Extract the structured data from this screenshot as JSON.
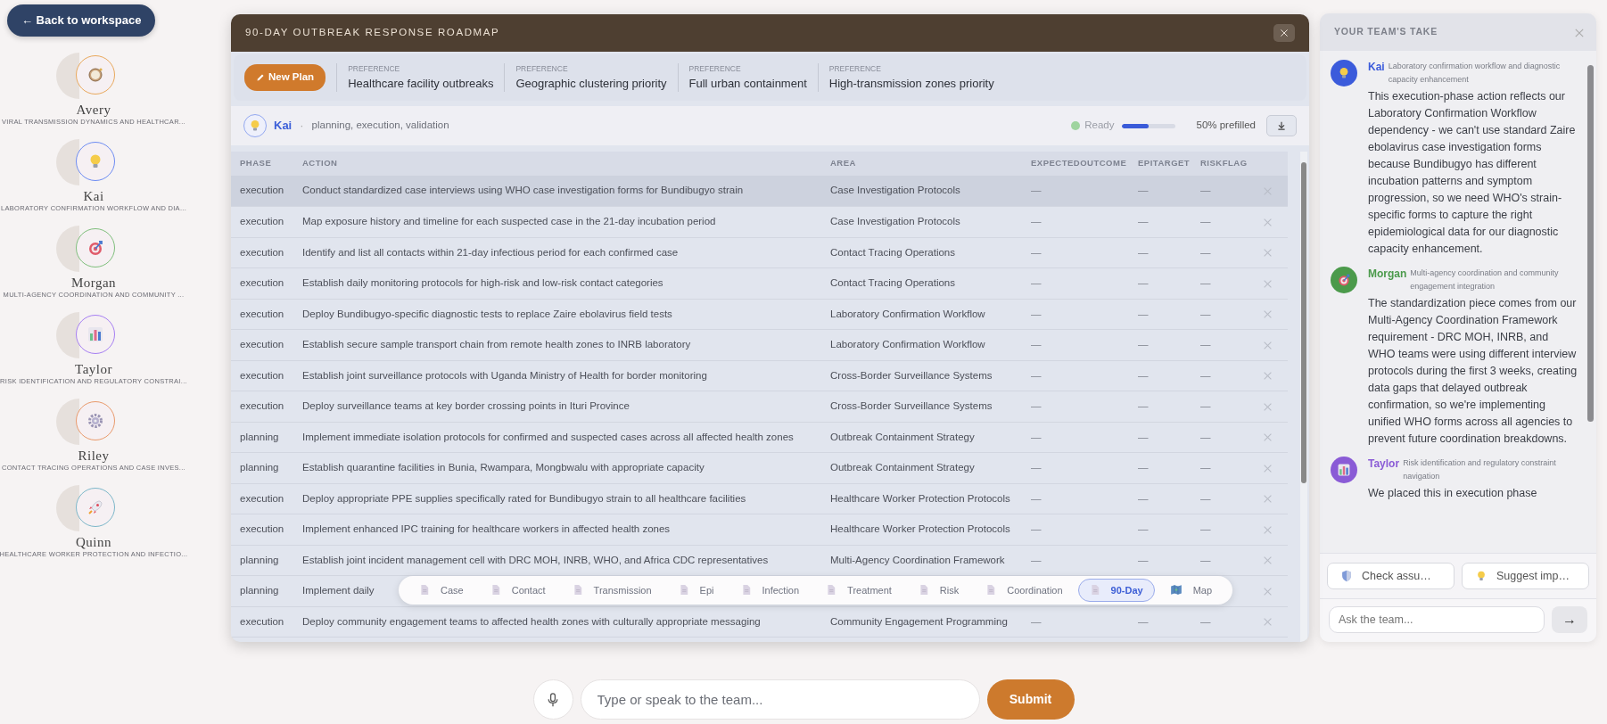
{
  "back_button": "← Back to workspace",
  "personas": [
    {
      "name": "Avery",
      "focus": "VIRAL TRANSMISSION DYNAMICS AND HEALTHCAR...",
      "color": "#e9a95c"
    },
    {
      "name": "Kai",
      "focus": "LABORATORY CONFIRMATION WORKFLOW AND DIA...",
      "color": "#6d8cf2"
    },
    {
      "name": "Morgan",
      "focus": "MULTI-AGENCY COORDINATION AND COMMUNITY ...",
      "color": "#7fbf7c"
    },
    {
      "name": "Taylor",
      "focus": "RISK IDENTIFICATION AND REGULATORY CONSTRAI...",
      "color": "#a67ff2"
    },
    {
      "name": "Riley",
      "focus": "CONTACT TRACING OPERATIONS AND CASE INVES...",
      "color": "#e99a6c"
    },
    {
      "name": "Quinn",
      "focus": "HEALTHCARE WORKER PROTECTION AND INFECTIO...",
      "color": "#7cb7c9"
    }
  ],
  "modal": {
    "title": "90-DAY OUTBREAK RESPONSE ROADMAP",
    "new_plan_button": "New Plan",
    "preferences": [
      {
        "label": "PREFERENCE",
        "value": "Healthcare facility outbreaks"
      },
      {
        "label": "PREFERENCE",
        "value": "Geographic clustering priority"
      },
      {
        "label": "PREFERENCE",
        "value": "Full urban containment"
      },
      {
        "label": "PREFERENCE",
        "value": "High-transmission zones priority"
      }
    ],
    "agent": {
      "name": "Kai",
      "separator": "·",
      "roles": "planning, execution, validation",
      "status": "Ready",
      "level": 0.5,
      "prefill": "50% prefilled"
    },
    "table": {
      "columns": [
        "PHASE",
        "ACTION",
        "AREA",
        "EXPECTEDOUTCOME",
        "EPITARGET",
        "RISKFLAG"
      ],
      "rows": [
        {
          "phase": "execution",
          "action": "Conduct standardized case interviews using WHO case investigation forms for Bundibugyo strain",
          "area": "Case Investigation Protocols",
          "expected_outcome": "—",
          "epi_target": "—",
          "risk_flag": "—",
          "selected": true
        },
        {
          "phase": "execution",
          "action": "Map exposure history and timeline for each suspected case in the 21-day incubation period",
          "area": "Case Investigation Protocols",
          "expected_outcome": "—",
          "epi_target": "—",
          "risk_flag": "—",
          "selected": false
        },
        {
          "phase": "execution",
          "action": "Identify and list all contacts within 21-day infectious period for each confirmed case",
          "area": "Contact Tracing Operations",
          "expected_outcome": "—",
          "epi_target": "—",
          "risk_flag": "—",
          "selected": false
        },
        {
          "phase": "execution",
          "action": "Establish daily monitoring protocols for high-risk and low-risk contact categories",
          "area": "Contact Tracing Operations",
          "expected_outcome": "—",
          "epi_target": "—",
          "risk_flag": "—",
          "selected": false
        },
        {
          "phase": "execution",
          "action": "Deploy Bundibugyo-specific diagnostic tests to replace Zaire ebolavirus field tests",
          "area": "Laboratory Confirmation Workflow",
          "expected_outcome": "—",
          "epi_target": "—",
          "risk_flag": "—",
          "selected": false
        },
        {
          "phase": "execution",
          "action": "Establish secure sample transport chain from remote health zones to INRB laboratory",
          "area": "Laboratory Confirmation Workflow",
          "expected_outcome": "—",
          "epi_target": "—",
          "risk_flag": "—",
          "selected": false
        },
        {
          "phase": "execution",
          "action": "Establish joint surveillance protocols with Uganda Ministry of Health for border monitoring",
          "area": "Cross-Border Surveillance Systems",
          "expected_outcome": "—",
          "epi_target": "—",
          "risk_flag": "—",
          "selected": false
        },
        {
          "phase": "execution",
          "action": "Deploy surveillance teams at key border crossing points in Ituri Province",
          "area": "Cross-Border Surveillance Systems",
          "expected_outcome": "—",
          "epi_target": "—",
          "risk_flag": "—",
          "selected": false
        },
        {
          "phase": "planning",
          "action": "Implement immediate isolation protocols for confirmed and suspected cases across all affected health zones",
          "area": "Outbreak Containment Strategy",
          "expected_outcome": "—",
          "epi_target": "—",
          "risk_flag": "—",
          "selected": false
        },
        {
          "phase": "planning",
          "action": "Establish quarantine facilities in Bunia, Rwampara, Mongbwalu with appropriate capacity",
          "area": "Outbreak Containment Strategy",
          "expected_outcome": "—",
          "epi_target": "—",
          "risk_flag": "—",
          "selected": false
        },
        {
          "phase": "execution",
          "action": "Deploy appropriate PPE supplies specifically rated for Bundibugyo strain to all healthcare facilities",
          "area": "Healthcare Worker Protection Protocols",
          "expected_outcome": "—",
          "epi_target": "—",
          "risk_flag": "—",
          "selected": false
        },
        {
          "phase": "execution",
          "action": "Implement enhanced IPC training for healthcare workers in affected health zones",
          "area": "Healthcare Worker Protection Protocols",
          "expected_outcome": "—",
          "epi_target": "—",
          "risk_flag": "—",
          "selected": false
        },
        {
          "phase": "planning",
          "action": "Establish joint incident management cell with DRC MOH, INRB, WHO, and Africa CDC representatives",
          "area": "Multi-Agency Coordination Framework",
          "expected_outcome": "—",
          "epi_target": "—",
          "risk_flag": "—",
          "selected": false
        },
        {
          "phase": "planning",
          "action": "Implement daily",
          "selected": false
        },
        {
          "phase": "execution",
          "action": "Deploy community engagement teams to affected health zones with culturally appropriate messaging",
          "area": "Community Engagement Programming",
          "expected_outcome": "—",
          "epi_target": "—",
          "risk_flag": "—",
          "selected": false
        }
      ]
    },
    "tabs": [
      {
        "label": "Case",
        "kind": "doc",
        "selected": false
      },
      {
        "label": "Contact",
        "kind": "doc",
        "selected": false
      },
      {
        "label": "Transmission",
        "kind": "doc",
        "selected": false
      },
      {
        "label": "Epi",
        "kind": "doc",
        "selected": false
      },
      {
        "label": "Infection",
        "kind": "doc",
        "selected": false
      },
      {
        "label": "Treatment",
        "kind": "doc",
        "selected": false
      },
      {
        "label": "Risk",
        "kind": "doc",
        "selected": false
      },
      {
        "label": "Coordination",
        "kind": "doc",
        "selected": false
      },
      {
        "label": "90-Day",
        "kind": "doc",
        "selected": true
      },
      {
        "label": "Map",
        "kind": "map",
        "selected": false
      }
    ]
  },
  "team_panel": {
    "title": "YOUR TEAM'S TAKE",
    "messages": [
      {
        "name": "Kai",
        "role": "Laboratory confirmation workflow and diagnostic capacity enhancement",
        "color": "#3b5bdb",
        "text": "This execution-phase action reflects our Laboratory Confirmation Workflow dependency - we can't use standard Zaire ebolavirus case investigation forms because Bundibugyo has different incubation patterns and symptom progression, so we need WHO's strain-specific forms to capture the right epidemiological data for our diagnostic capacity enhancement."
      },
      {
        "name": "Morgan",
        "role": "Multi-agency coordination and community engagement integration",
        "color": "#4b9a4b",
        "text": "The standardization piece comes from our Multi-Agency Coordination Framework requirement - DRC MOH, INRB, and WHO teams were using different interview protocols during the first 3 weeks, creating data gaps that delayed outbreak confirmation, so we're implementing unified WHO forms across all agencies to prevent future coordination breakdowns."
      },
      {
        "name": "Taylor",
        "role": "Risk identification and regulatory constraint navigation",
        "color": "#8a5bd6",
        "text": "We placed this in execution phase"
      }
    ],
    "actions": [
      "Check assu…",
      "Suggest imp…"
    ],
    "ask_placeholder": "Ask the team...",
    "send_button": "→"
  },
  "composer": {
    "placeholder": "Type or speak to the team...",
    "submit": "Submit"
  }
}
